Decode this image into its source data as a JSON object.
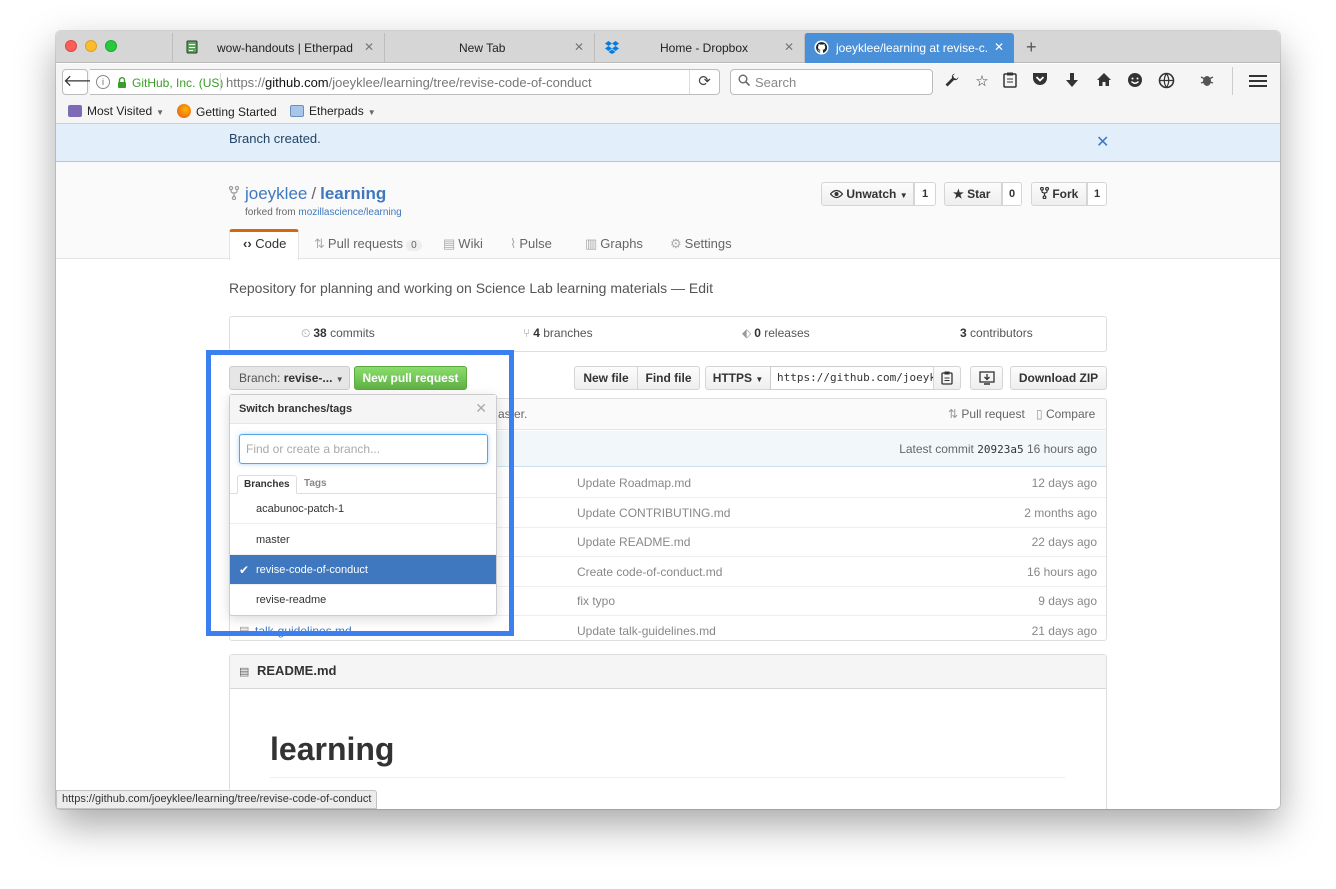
{
  "browser": {
    "tabs": [
      {
        "title": "wow-handouts | Etherpad",
        "icon": "etherpad-icon"
      },
      {
        "title": "New Tab",
        "icon": ""
      },
      {
        "title": "Home - Dropbox",
        "icon": "dropbox-icon"
      },
      {
        "title": "joeyklee/learning at revise-c...",
        "icon": "github-icon",
        "active": true
      }
    ],
    "url_org": "GitHub, Inc. (US)",
    "url_prefix": "https://",
    "url_host": "github.com",
    "url_path": "/joeyklee/learning/tree/revise-code-of-conduct",
    "search_placeholder": "Search",
    "bookmarks": [
      {
        "label": "Most Visited",
        "icon": "most-visited-icon"
      },
      {
        "label": "Getting Started",
        "icon": "firefox-icon"
      },
      {
        "label": "Etherpads",
        "icon": "folder-icon"
      }
    ],
    "status_url": "https://github.com/joeyklee/learning/tree/revise-code-of-conduct"
  },
  "flash": {
    "message": "Branch created."
  },
  "repo": {
    "owner": "joeyklee",
    "name": "learning",
    "forked_from_prefix": "forked from",
    "forked_from": "mozillascience/learning",
    "unwatch_label": "Unwatch",
    "unwatch_count": "1",
    "star_label": "Star",
    "star_count": "0",
    "fork_label": "Fork",
    "fork_count": "1",
    "description": "Repository for planning and working on Science Lab learning materials — Edit"
  },
  "reponav": {
    "code": "Code",
    "pull_requests": "Pull requests",
    "pull_requests_count": "0",
    "wiki": "Wiki",
    "pulse": "Pulse",
    "graphs": "Graphs",
    "settings": "Settings"
  },
  "numbers": {
    "commits_count": "38",
    "commits_label": "commits",
    "branches_count": "4",
    "branches_label": "branches",
    "releases_count": "0",
    "releases_label": "releases",
    "contributors_count": "3",
    "contributors_label": "contributors"
  },
  "filenav": {
    "branch_prefix": "Branch:",
    "branch_name": "revise-...",
    "new_pr": "New pull request",
    "new_file": "New file",
    "find_file": "Find file",
    "https": "HTTPS",
    "clone_url": "https://github.com/joeyklee/learning.git",
    "download_zip": "Download ZIP"
  },
  "commit_tease": {
    "partial_text": "aster.",
    "pull_request": "Pull request",
    "compare": "Compare",
    "latest_commit_label": "Latest commit",
    "sha": "20923a5",
    "age": "16 hours ago"
  },
  "files": [
    {
      "name": "",
      "message": "Update Roadmap.md",
      "age": "12 days ago"
    },
    {
      "name": "",
      "message": "Update CONTRIBUTING.md",
      "age": "2 months ago"
    },
    {
      "name": "",
      "message": "Update README.md",
      "age": "22 days ago"
    },
    {
      "name": "",
      "message": "Create code-of-conduct.md",
      "age": "16 hours ago"
    },
    {
      "name": "",
      "message": "fix typo",
      "age": "9 days ago"
    },
    {
      "name": "talk-guidelines.md",
      "message": "Update talk-guidelines.md",
      "age": "21 days ago"
    }
  ],
  "readme": {
    "filename": "README.md",
    "heading": "learning"
  },
  "dropdown": {
    "title": "Switch branches/tags",
    "filter_placeholder": "Find or create a branch...",
    "tab_branches": "Branches",
    "tab_tags": "Tags",
    "branches": [
      "acabunoc-patch-1",
      "master",
      "revise-code-of-conduct",
      "revise-readme"
    ],
    "selected_branch": "revise-code-of-conduct"
  },
  "colors": {
    "highlight_box": "#3b7ff0",
    "selected_item": "#4078c0",
    "pr_button": "#60b044",
    "active_tab": "#4a90d9"
  }
}
